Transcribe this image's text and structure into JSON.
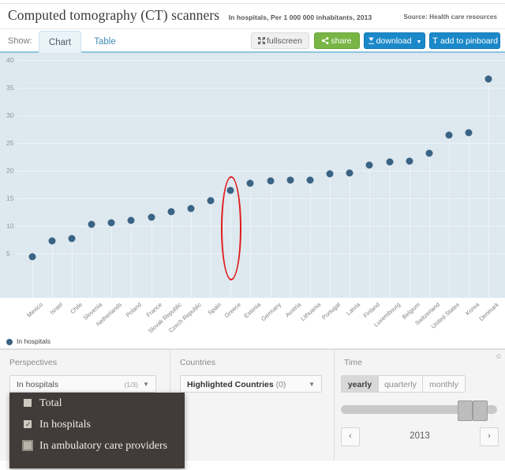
{
  "header": {
    "title": "Computed tomography (CT) scanners",
    "subtitle": "In hospitals, Per 1 000 000 inhabitants, 2013",
    "source": "Source: Health care resources"
  },
  "toolbar": {
    "show_label": "Show:",
    "tab_chart": "Chart",
    "tab_table": "Table",
    "fullscreen": "fullscreen",
    "share": "share",
    "download": "download",
    "pinboard": "add to pinboard",
    "fullscreen_icon": "expand-arrows-icon",
    "share_icon": "share-nodes-icon",
    "download_icon": "download-icon",
    "pinboard_icon": "pin-icon",
    "caret": "▼"
  },
  "legend": {
    "label": "In hospitals",
    "color": "#3a6384"
  },
  "panels": {
    "perspectives": {
      "title": "Perspectives",
      "selected": "In hospitals",
      "fraction": "(1/3)",
      "caret": "▼",
      "options": [
        {
          "label": "Total",
          "checked": false,
          "focused": false
        },
        {
          "label": "In hospitals",
          "checked": true,
          "focused": false
        },
        {
          "label": "In ambulatory care providers",
          "checked": false,
          "focused": true
        }
      ]
    },
    "countries": {
      "title": "Countries",
      "selected": "Highlighted Countries",
      "count": "(0)",
      "caret": "▼"
    },
    "time": {
      "title": "Time",
      "copyright": "©",
      "granularity": [
        "yearly",
        "quarterly",
        "monthly"
      ],
      "granularity_selected": "yearly",
      "year": "2013",
      "prev": "‹",
      "next": "›"
    }
  },
  "chart_data": {
    "type": "scatter",
    "title": "Computed tomography (CT) scanners",
    "subtitle": "In hospitals, Per 1 000 000 inhabitants, 2013",
    "xlabel": "",
    "ylabel": "",
    "ylim": [
      0,
      42
    ],
    "yticks": [
      5,
      10,
      15,
      20,
      25,
      30,
      35,
      40
    ],
    "grid": true,
    "legend_position": "bottom-left",
    "series_name": "In hospitals",
    "marker_color": "#3a6384",
    "plot_background": "#dde8ef",
    "categories": [
      "Mexico",
      "Israel",
      "Chile",
      "Slovenia",
      "Netherlands",
      "Poland",
      "France",
      "Slovak Republic",
      "Czech Republic",
      "Spain",
      "Greece",
      "Estonia",
      "Germany",
      "Austria",
      "Lithuania",
      "Portugal",
      "Latvia",
      "Finland",
      "Luxembourg",
      "Belgium",
      "Switzerland",
      "United States",
      "Korea",
      "Denmark"
    ],
    "values": [
      4.4,
      7.3,
      7.7,
      10.3,
      10.6,
      11.0,
      11.6,
      12.6,
      13.1,
      14.6,
      16.5,
      17.7,
      18.1,
      18.3,
      18.3,
      19.4,
      19.6,
      21.0,
      21.6,
      21.7,
      23.1,
      26.4,
      26.9,
      36.6
    ],
    "annotation": {
      "type": "ellipse",
      "target": "Greece",
      "color": "#e01b1b"
    }
  }
}
